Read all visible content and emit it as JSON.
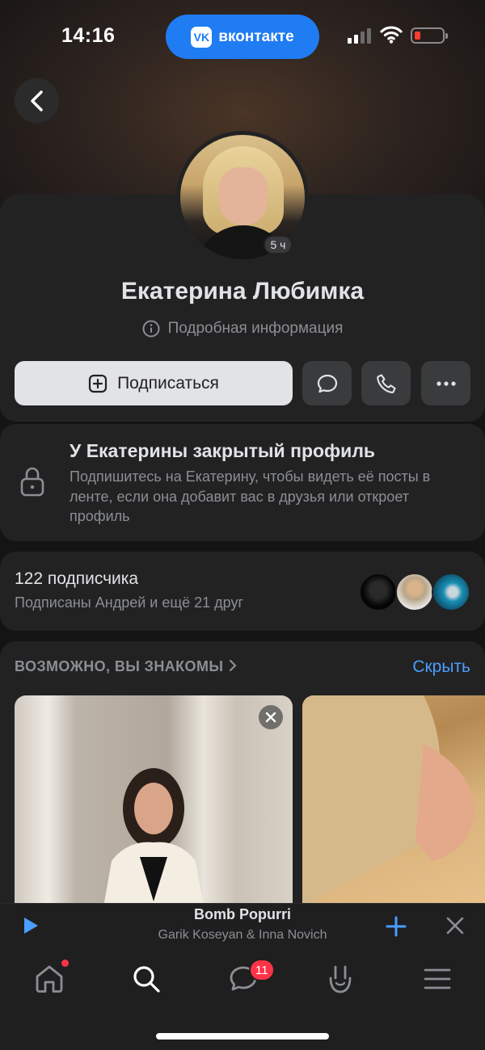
{
  "status_bar": {
    "time": "14:16",
    "app_pill_label": "вконтакте",
    "app_logo": "VK"
  },
  "profile": {
    "name": "Екатерина Любимка",
    "online_badge": "5 ч",
    "details_link": "Подробная информация"
  },
  "actions": {
    "subscribe_label": "Подписаться"
  },
  "closed_profile": {
    "title": "У Екатерины закрытый профиль",
    "text": "Подпишитесь на Екатерину, чтобы видеть её посты в ленте, если она добавит вас в друзья или откроет профиль"
  },
  "followers": {
    "count": "122 подписчика",
    "subtitle": "Подписаны Андрей и ещё 21 друг"
  },
  "suggestions": {
    "title": "ВОЗМОЖНО, ВЫ ЗНАКОМЫ",
    "hide_label": "Скрыть"
  },
  "player": {
    "track_title": "Bomb Popurri",
    "track_artist": "Garik Koseyan & Inna Novich"
  },
  "tabbar": {
    "messages_badge": "11",
    "tabs": [
      "home-icon",
      "search-icon",
      "messages-icon",
      "clips-icon",
      "menu-icon"
    ]
  },
  "colors": {
    "accent": "#1f7cf3",
    "link": "#4a9eff",
    "badge": "#ff3347",
    "background": "#141414",
    "card": "#222223"
  }
}
